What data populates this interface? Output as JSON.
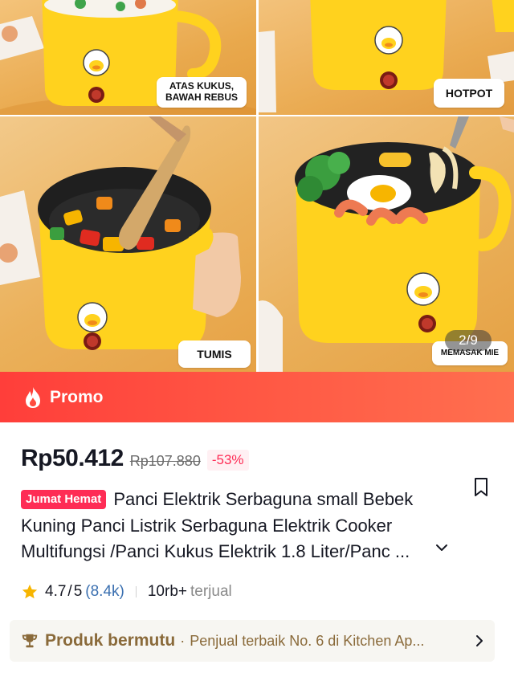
{
  "gallery": {
    "labels": {
      "steam": "ATAS KUKUS,\nBAWAH REBUS",
      "hotpot": "HOTPOT",
      "stirfry": "TUMIS",
      "noodle": "MEMASAK MIE"
    },
    "counter": "2/9"
  },
  "promo": {
    "label": "Promo"
  },
  "product": {
    "price": "Rp50.412",
    "original_price": "Rp107.880",
    "discount": "-53%",
    "tag": "Jumat Hemat",
    "title": "Panci Elektrik Serbaguna small Bebek Kuning Panci Listrik Serbaguna Elektrik Cooker Multifungsi /Panci Kukus Elektrik 1.8 Liter/Panc ...",
    "rating": "4.7",
    "rating_max": "5",
    "reviews": "(8.4k)",
    "sold_count": "10rb+",
    "sold_label": "terjual"
  },
  "quality": {
    "title": "Produk bermutu",
    "separator": "·",
    "desc": "Penjual terbaik No. 6 di Kitchen Ap..."
  },
  "colors": {
    "promo_start": "#ff3e3a",
    "promo_end": "#ff6f4f",
    "discount": "#fe2c55",
    "tag_bg": "#fe2c55",
    "review_link": "#3a6fb0",
    "quality_text": "#8a6a3a",
    "star": "#f7b500"
  },
  "icons": [
    "fire-icon",
    "bookmark-icon",
    "chevron-down-icon",
    "star-icon",
    "trophy-icon",
    "chevron-right-icon"
  ]
}
